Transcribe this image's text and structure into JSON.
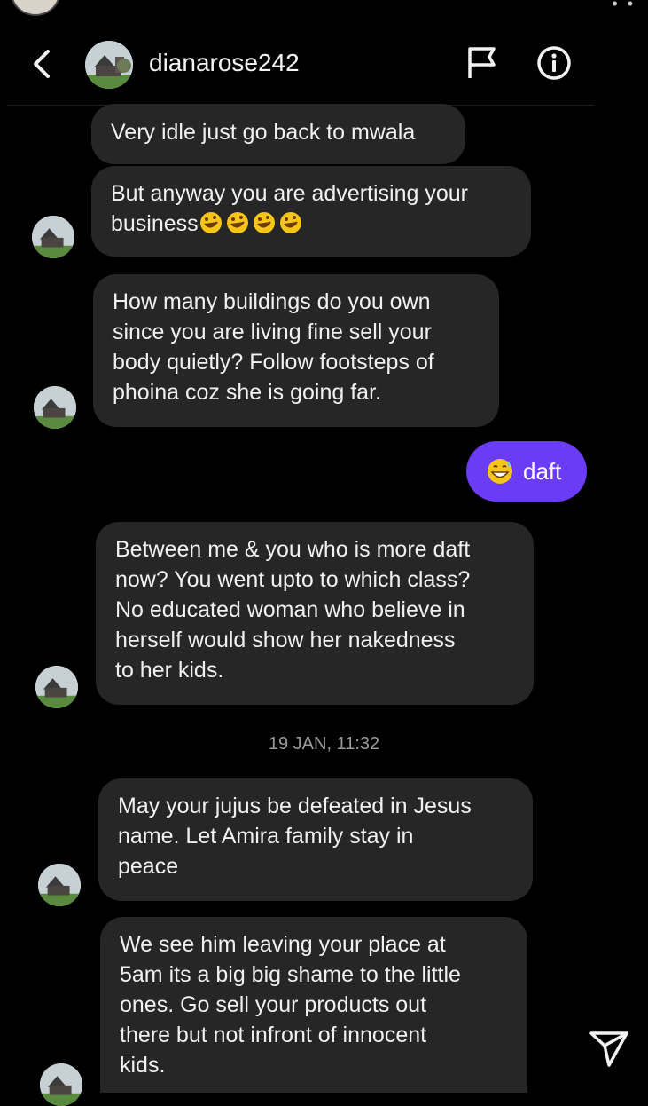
{
  "header": {
    "username": "dianarose242"
  },
  "messages": [
    {
      "lines": [
        "Very idle just go back to mwala"
      ]
    },
    {
      "lines": [
        "But anyway you are advertising your",
        "business"
      ],
      "emoji_count": 4
    },
    {
      "lines": [
        "How many buildings do you own",
        "since you are living fine sell your",
        "body quietly? Follow footsteps of",
        "phoina coz she is going far."
      ]
    },
    {
      "text": "daft"
    },
    {
      "lines": [
        "Between me & you who is more daft",
        "now? You went upto to which class?",
        "No educated woman who believe in",
        "herself would show her nakedness",
        "to her kids."
      ]
    },
    {
      "lines": [
        "May your jujus be defeated in Jesus",
        "name. Let Amira family stay in",
        "peace"
      ]
    },
    {
      "lines": [
        "We see him leaving your place at",
        "5am its a big big shame to the little",
        "ones. Go sell your products out",
        "there but not infront of innocent",
        "kids."
      ]
    }
  ],
  "timestamp": "19 JAN, 11:32",
  "icons": {
    "back": "chevron-left-icon",
    "flag": "flag-icon",
    "info": "info-icon",
    "send": "paper-plane-icon",
    "laugh_emoji": "rolling-on-floor-laughing-emoji",
    "sweat_emoji": "grinning-sweat-emoji"
  },
  "colors": {
    "background": "#000000",
    "received_bubble": "#262626",
    "sent_bubble": "#6b3cf5",
    "text": "#f0f0f0"
  }
}
